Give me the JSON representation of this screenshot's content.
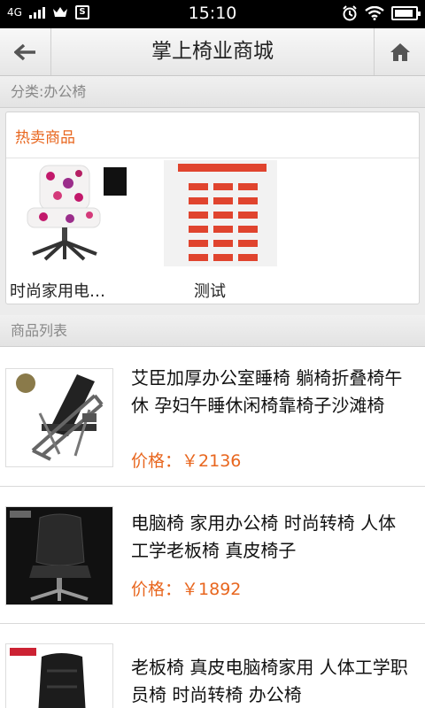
{
  "status": {
    "network": "4G",
    "time": "15:10"
  },
  "header": {
    "title": "掌上椅业商城"
  },
  "category": {
    "label": "分类:办公椅"
  },
  "hot": {
    "title": "热卖商品",
    "items": [
      {
        "name": "时尚家用电…"
      },
      {
        "name": "测试"
      }
    ]
  },
  "list": {
    "title": "商品列表",
    "price_label": "价格：",
    "products": [
      {
        "title": "艾臣加厚办公室睡椅 躺椅折叠椅午休 孕妇午睡休闲椅靠椅子沙滩椅",
        "price": "￥2136"
      },
      {
        "title": "电脑椅 家用办公椅 时尚转椅 人体工学老板椅 真皮椅子",
        "price": "￥1892"
      },
      {
        "title": "老板椅 真皮电脑椅家用 人体工学职员椅 时尚转椅 办公椅",
        "price": ""
      }
    ]
  },
  "colors": {
    "accent": "#e8661e",
    "statusbar": "#000000"
  }
}
